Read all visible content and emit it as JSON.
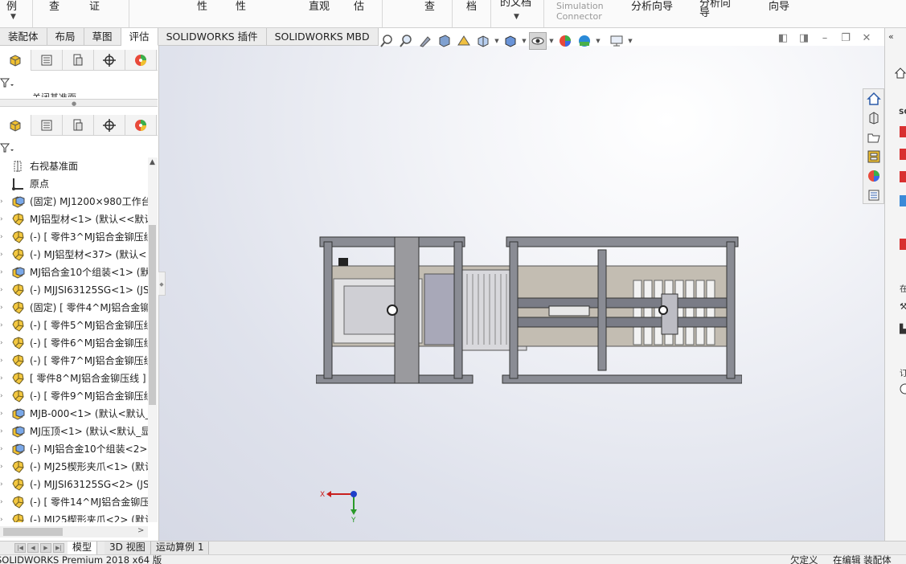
{
  "ribbon": {
    "items": [
      {
        "label": "例",
        "has_arrow": true
      },
      {
        "label": "查"
      },
      {
        "label": "证"
      },
      {
        "label": "性"
      },
      {
        "label": "性"
      },
      {
        "label": "直观"
      },
      {
        "label": "估"
      },
      {
        "label": "查"
      },
      {
        "label": "档"
      },
      {
        "label": "的文档",
        "has_arrow": true
      },
      {
        "label": "Simulation\nConnector",
        "disabled": true
      },
      {
        "label": "分析向导"
      },
      {
        "label": "分析向\n导"
      },
      {
        "label": "向导"
      }
    ]
  },
  "command_tabs": [
    {
      "label": "装配体"
    },
    {
      "label": "布局"
    },
    {
      "label": "草图"
    },
    {
      "label": "评估",
      "active": true
    },
    {
      "label": "SOLIDWORKS 插件"
    },
    {
      "label": "SOLIDWORKS MBD"
    }
  ],
  "panel_tabs": [
    "feature-manager",
    "property-manager",
    "configuration-manager",
    "dimxpert-manager",
    "display-manager"
  ],
  "tree": {
    "items": [
      {
        "icon": "plane-icon",
        "label": "右视基准面",
        "expand": false
      },
      {
        "icon": "origin-icon",
        "label": "原点",
        "expand": false
      },
      {
        "icon": "assembly-icon",
        "label": "(固定) MJ1200×980工作台",
        "expand": true
      },
      {
        "icon": "part-icon",
        "label": "MJ铝型材<1> (默认<<默认",
        "expand": true
      },
      {
        "icon": "part-icon",
        "label": "(-) [ 零件3^MJ铝合金铆压线",
        "expand": true
      },
      {
        "icon": "part-icon",
        "label": "(-) MJ铝型材<37> (默认<",
        "expand": true
      },
      {
        "icon": "assembly-icon",
        "label": "MJ铝合金10个组装<1> (默",
        "expand": true
      },
      {
        "icon": "part-icon",
        "label": "(-) MJJSI63125SG<1> (JS",
        "expand": true
      },
      {
        "icon": "part-icon",
        "label": "(固定) [ 零件4^MJ铝合金铆",
        "expand": true
      },
      {
        "icon": "part-icon",
        "label": "(-) [ 零件5^MJ铝合金铆压线",
        "expand": true
      },
      {
        "icon": "part-icon",
        "label": "(-) [ 零件6^MJ铝合金铆压线",
        "expand": true
      },
      {
        "icon": "part-icon",
        "label": "(-) [ 零件7^MJ铝合金铆压线",
        "expand": true
      },
      {
        "icon": "part-icon",
        "label": "[ 零件8^MJ铝合金铆压线 ]",
        "expand": true
      },
      {
        "icon": "part-icon",
        "label": "(-) [ 零件9^MJ铝合金铆压线",
        "expand": true
      },
      {
        "icon": "assembly-icon",
        "label": "MJB-000<1> (默认<默认_",
        "expand": true
      },
      {
        "icon": "assembly-icon",
        "label": "MJ压顶<1> (默认<默认_显",
        "expand": true
      },
      {
        "icon": "assembly-icon",
        "label": "(-) MJ铝合金10个组装<2>",
        "expand": true
      },
      {
        "icon": "part-icon",
        "label": "(-) MJ25楔形夹爪<1> (默认",
        "expand": true
      },
      {
        "icon": "part-icon",
        "label": "(-) MJJSI63125SG<2> (JS",
        "expand": true
      },
      {
        "icon": "part-icon",
        "label": "(-) [ 零件14^MJ铝合金铆压",
        "expand": true
      },
      {
        "icon": "part-icon",
        "label": "(-) MJ25楔形夹爪<2> (默认",
        "expand": true
      }
    ]
  },
  "top_tree_partial": "关闭基准面",
  "bottom_tabs": [
    {
      "label": "模型",
      "active": true
    },
    {
      "label": "3D 视图"
    },
    {
      "label": "运动算例 1"
    }
  ],
  "status": {
    "left": "SOLIDWORKS Premium 2018 x64 版",
    "custom": "欠定义",
    "editing": "在编辑 装配体"
  },
  "triad": {
    "x": "X",
    "y": "Y"
  },
  "taskpane_partial": {
    "a": "SO",
    "b": "在",
    "c": "订"
  },
  "colors": {
    "accent_blue": "#1e6fc8",
    "model_frame": "#8a8c94",
    "model_plate": "#c3bdb2"
  }
}
